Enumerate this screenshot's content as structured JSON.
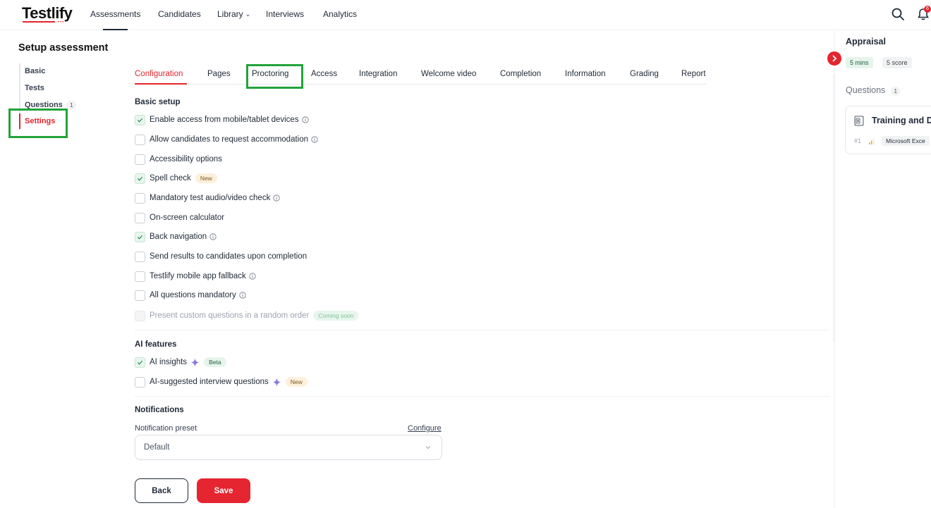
{
  "topnav": {
    "logo": "Testlify",
    "logo_tagline": "•••",
    "items": [
      "Assessments",
      "Candidates",
      "Library",
      "Interviews",
      "Analytics"
    ],
    "notification_count": "6"
  },
  "left": {
    "title": "Setup assessment",
    "items": [
      {
        "label": "Basic"
      },
      {
        "label": "Tests"
      },
      {
        "label": "Questions",
        "count": "1"
      },
      {
        "label": "Settings"
      }
    ]
  },
  "tabs": [
    "Configuration",
    "Pages",
    "Proctoring",
    "Access",
    "Integration",
    "Welcome video",
    "Completion",
    "Information",
    "Grading",
    "Report"
  ],
  "basic_setup": {
    "title": "Basic setup",
    "options": [
      {
        "label": "Enable access from mobile/tablet devices",
        "checked": true,
        "info": true
      },
      {
        "label": "Allow candidates to request accommodation",
        "checked": false,
        "info": true
      },
      {
        "label": "Accessibility options",
        "checked": false
      },
      {
        "label": "Spell check",
        "checked": true,
        "badge": "New"
      },
      {
        "label": "Mandatory test audio/video check",
        "checked": false,
        "info": true
      },
      {
        "label": "On-screen calculator",
        "checked": false
      },
      {
        "label": "Back navigation",
        "checked": true,
        "info": true
      },
      {
        "label": "Send results to candidates upon completion",
        "checked": false
      },
      {
        "label": "Testlify mobile app fallback",
        "checked": false,
        "info": true
      },
      {
        "label": "All questions mandatory",
        "checked": false,
        "info": true
      },
      {
        "label": "Present custom questions in a random order",
        "checked": false,
        "disabled": true,
        "badge": "Coming soon"
      }
    ]
  },
  "ai_features": {
    "title": "AI features",
    "options": [
      {
        "label": "AI insights",
        "checked": true,
        "badge": "Beta"
      },
      {
        "label": "AI-suggested interview questions",
        "checked": false,
        "badge": "New"
      }
    ]
  },
  "notifications": {
    "title": "Notifications",
    "preset_label": "Notification preset",
    "configure_link": "Configure",
    "preset_value": "Default"
  },
  "buttons": {
    "back": "Back",
    "save": "Save"
  },
  "right_panel": {
    "title": "Appraisal",
    "duration": "5 mins",
    "score": "5 score",
    "questions_label": "Questions",
    "questions_count": "1",
    "question_card": {
      "title": "Training and D",
      "number": "#1",
      "tag": "Microsoft Exce"
    }
  },
  "colors": {
    "accent": "#e5252f",
    "highlight": "#22a33a",
    "check_bg": "#e8f6ee"
  }
}
